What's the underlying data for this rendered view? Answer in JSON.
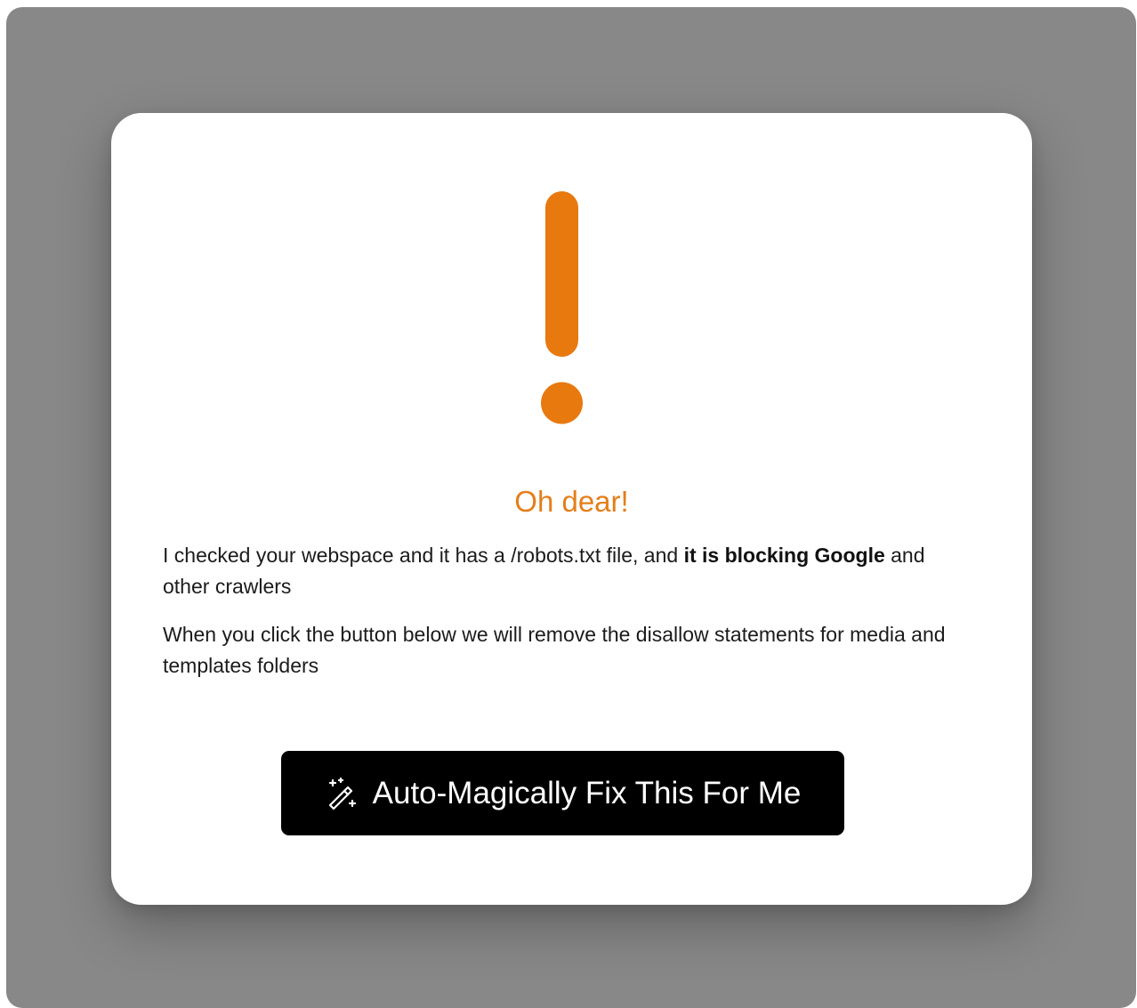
{
  "modal": {
    "title": "Oh dear!",
    "message_1": {
      "text_before": "I checked your webspace and it has a /robots.txt file, and ",
      "bold": "it is blocking Google",
      "text_after": " and other crawlers"
    },
    "message_2": "When you click the button below we will remove the disallow statements for media and templates folders",
    "button": {
      "label": "Auto-Magically Fix This For Me",
      "icon": "magic-wand-icon"
    },
    "alert_icon": "exclamation-icon"
  },
  "colors": {
    "accent": "#e8790f",
    "title": "#e47e1a",
    "backdrop": "#888888",
    "button_bg": "#000000",
    "button_text": "#ffffff"
  }
}
